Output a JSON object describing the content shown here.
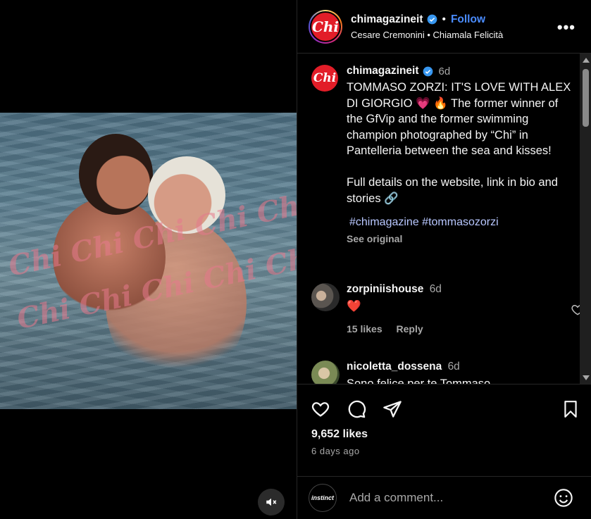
{
  "media": {
    "watermark_row1": "Chi Chi Chi Chi Chi",
    "watermark_row2": "Chi Chi Chi Chi Chi"
  },
  "header": {
    "logo_text": "Chi",
    "username": "chimagazineit",
    "follow_label": "Follow",
    "separator": "•",
    "audio": "Cesare Cremonini • Chiamala Felicità",
    "more_label": "•••"
  },
  "caption": {
    "logo_text": "Chi",
    "username": "chimagazineit",
    "time": "6d",
    "text": "TOMMASO ZORZI: IT'S LOVE WITH ALEX DI GIORGIO 💗  🔥 The former winner of the GfVip and the former swimming champion photographed by “Chi” in Pantelleria between the sea and kisses!\n\nFull details on the website, link in bio and stories 🔗",
    "hashtags": "#chimagazine #tommasozorzi",
    "see_original": "See original"
  },
  "comments": [
    {
      "username": "zorpiniishouse",
      "time": "6d",
      "text": "❤️",
      "likes": "15 likes",
      "reply": "Reply"
    },
    {
      "username": "nicoletta_dossena",
      "time": "6d",
      "text": "Sono felice per te Tommaso"
    }
  ],
  "stats": {
    "likes": "9,652 likes",
    "ago": "6 days ago"
  },
  "add_comment": {
    "avatar_text": "instinct",
    "placeholder": "Add a comment..."
  },
  "colors": {
    "accent": "#4a8cff",
    "chi_red": "#e21d28",
    "muted": "#a8a8a8",
    "background": "#000000"
  }
}
